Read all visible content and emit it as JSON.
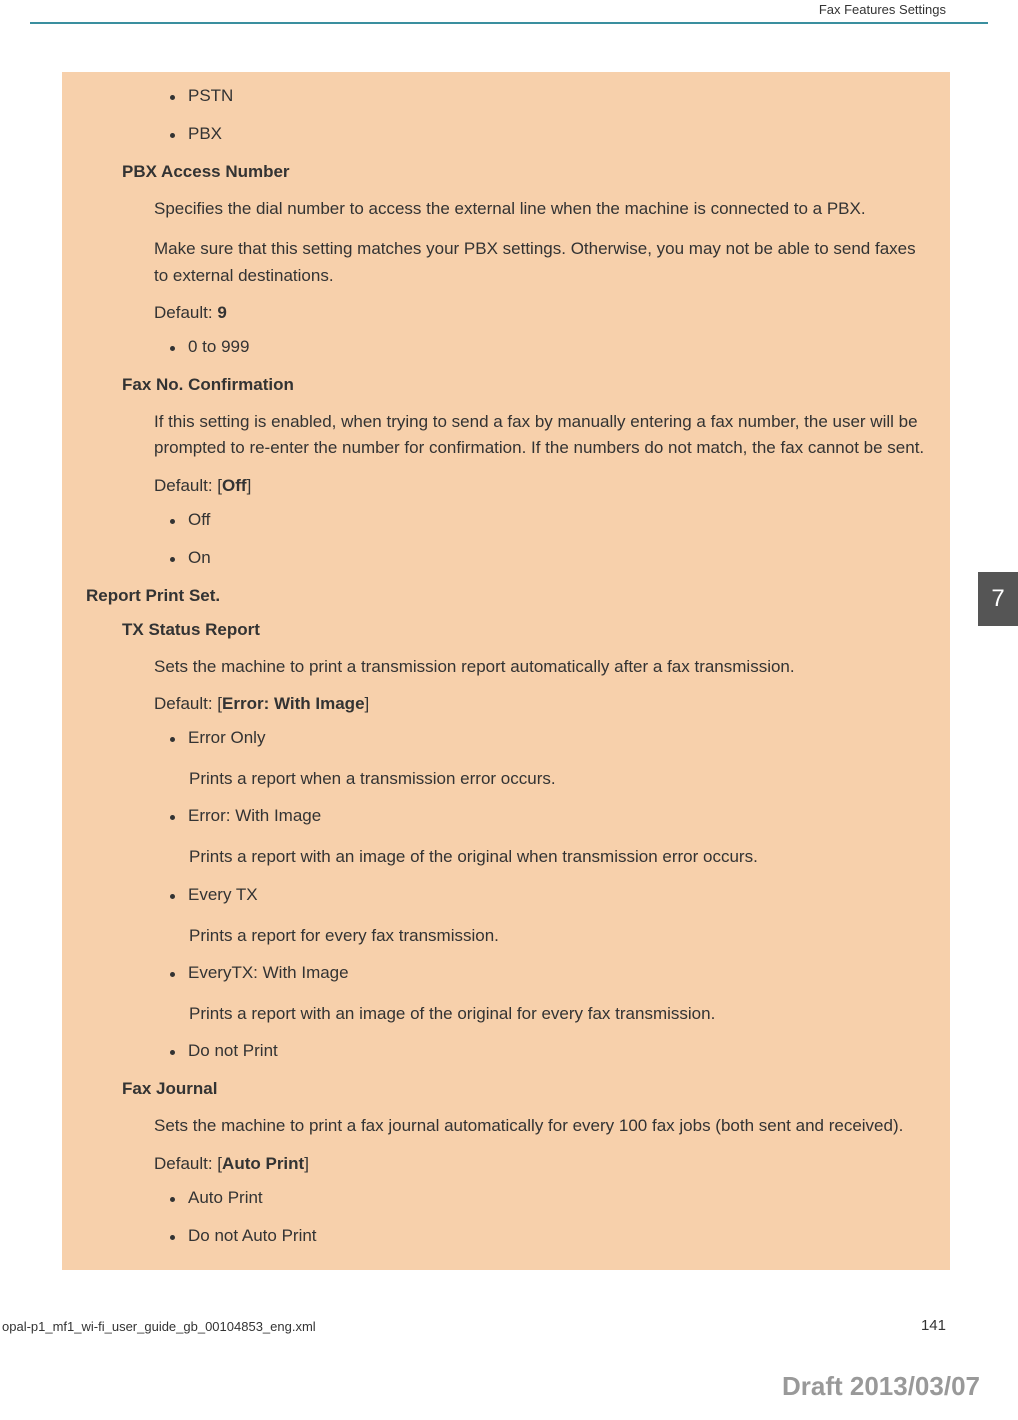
{
  "header": {
    "title": "Fax Features Settings"
  },
  "side_tab": "7",
  "content": {
    "top_bullets": [
      "PSTN",
      "PBX"
    ],
    "pbx_access": {
      "title": "PBX Access Number",
      "text1": "Specifies the dial number to access the external line when the machine is connected to a PBX.",
      "text2": "Make sure that this setting matches your PBX settings. Otherwise, you may not be able to send faxes to external destinations.",
      "default_prefix": "Default: ",
      "default_value": "9",
      "options": [
        "0 to 999"
      ]
    },
    "fax_no_confirm": {
      "title": "Fax No. Confirmation",
      "text1": "If this setting is enabled, when trying to send a fax by manually entering a fax number, the user will be prompted to re-enter the number for confirmation. If the numbers do not match, the fax cannot be sent.",
      "default_prefix": "Default: [",
      "default_value": "Off",
      "default_suffix": "]",
      "options": [
        "Off",
        "On"
      ]
    },
    "report_print": {
      "title": "Report Print Set.",
      "tx_status": {
        "title": "TX Status Report",
        "text1": "Sets the machine to print a transmission report automatically after a fax transmission.",
        "default_prefix": "Default: [",
        "default_value": "Error: With Image",
        "default_suffix": "]",
        "options": [
          {
            "name": "Error Only",
            "desc": "Prints a report when a transmission error occurs."
          },
          {
            "name": "Error: With Image",
            "desc": "Prints a report with an image of the original when transmission error occurs."
          },
          {
            "name": "Every TX",
            "desc": "Prints a report for every fax transmission."
          },
          {
            "name": "EveryTX: With Image",
            "desc": "Prints a report with an image of the original for every fax transmission."
          },
          {
            "name": "Do not Print",
            "desc": ""
          }
        ]
      },
      "fax_journal": {
        "title": "Fax Journal",
        "text1": "Sets the machine to print a fax journal automatically for every 100 fax jobs (both sent and received).",
        "default_prefix": "Default: [",
        "default_value": "Auto Print",
        "default_suffix": "]",
        "options": [
          "Auto Print",
          "Do not Auto Print"
        ]
      }
    }
  },
  "footer": {
    "left": "opal-p1_mf1_wi-fi_user_guide_gb_00104853_eng.xml",
    "right": "141",
    "draft": "Draft 2013/03/07"
  }
}
